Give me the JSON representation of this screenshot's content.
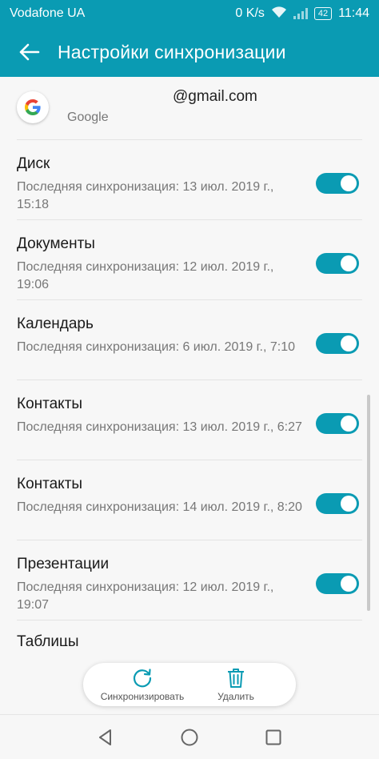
{
  "status_bar": {
    "carrier": "Vodafone UA",
    "speed": "0 K/s",
    "battery": "42",
    "time": "11:44"
  },
  "app_bar": {
    "title": "Настройки синхронизации",
    "back_icon": "arrow-left-icon"
  },
  "account": {
    "email": "@gmail.com",
    "type": "Google",
    "logo_icon": "google-icon"
  },
  "sync_items": [
    {
      "title": "Диск",
      "subtitle": "Последняя синхронизация: 13 июл. 2019 г., 15:18",
      "enabled": true
    },
    {
      "title": "Документы",
      "subtitle": "Последняя синхронизация: 12 июл. 2019 г., 19:06",
      "enabled": true
    },
    {
      "title": "Календарь",
      "subtitle": "Последняя синхронизация: 6 июл. 2019 г., 7:10",
      "enabled": true
    },
    {
      "title": "Контакты",
      "subtitle": "Последняя синхронизация: 13 июл. 2019 г., 6:27",
      "enabled": true
    },
    {
      "title": "Контакты",
      "subtitle": "Последняя синхронизация: 14 июл. 2019 г., 8:20",
      "enabled": true
    },
    {
      "title": "Презентации",
      "subtitle": "Последняя синхронизация: 12 июл. 2019 г., 19:07",
      "enabled": true
    },
    {
      "title": "Таблицы",
      "subtitle": "",
      "enabled": true
    }
  ],
  "actions": {
    "sync_label": "Синхронизировать",
    "delete_label": "Удалить"
  },
  "colors": {
    "accent": "#0a9bb3"
  }
}
